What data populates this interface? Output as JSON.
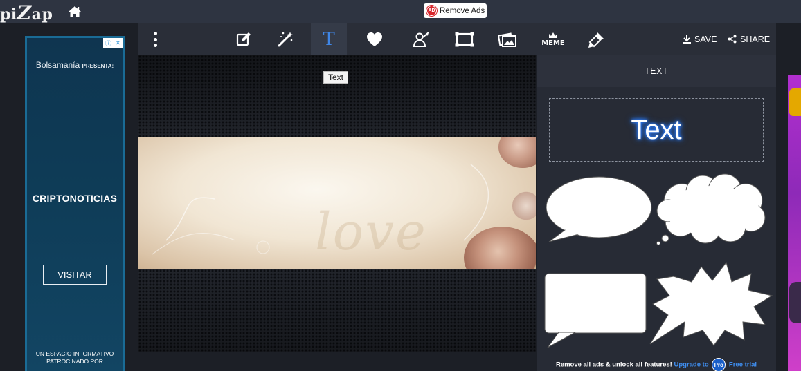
{
  "app": {
    "logo_prefix": "pi",
    "logo_big": "Z",
    "logo_suffix": "ap",
    "remove_ads_label": "Remove Ads",
    "ad_badge_text": "AD"
  },
  "left_ad": {
    "brand": "Bolsamanía",
    "brand_suffix": "PRESENTA:",
    "title": "CRIPTONOTICIAS",
    "cta": "VISITAR",
    "footer_line1": "UN ESPACIO INFORMATIVO",
    "footer_line2": "PATROCINADO POR"
  },
  "toolbar": {
    "tools": [
      {
        "id": "edit",
        "icon": "edit-icon"
      },
      {
        "id": "effects",
        "icon": "magic-wand-icon"
      },
      {
        "id": "text",
        "icon": "text-icon",
        "label": "T",
        "active": true
      },
      {
        "id": "stickers",
        "icon": "heart-icon"
      },
      {
        "id": "cutout",
        "icon": "cutout-icon"
      },
      {
        "id": "frames",
        "icon": "frame-icon"
      },
      {
        "id": "collage",
        "icon": "collage-icon"
      },
      {
        "id": "meme",
        "icon": "meme-icon",
        "label": "MEME"
      },
      {
        "id": "paint",
        "icon": "paint-brush-icon"
      }
    ],
    "save_label": "SAVE",
    "share_label": "SHARE",
    "tooltip": "Text"
  },
  "canvas": {
    "photo_text": "love"
  },
  "panel": {
    "title": "TEXT",
    "text_sample": "Text",
    "promo_text": "Remove all ads & unlock all features!",
    "promo_upgrade": "Upgrade to",
    "promo_pro": "Pro",
    "promo_trial": "Free trial"
  },
  "colors": {
    "accent_blue": "#3f86e6",
    "topbar": "#2e3441",
    "panel": "#272b35"
  }
}
